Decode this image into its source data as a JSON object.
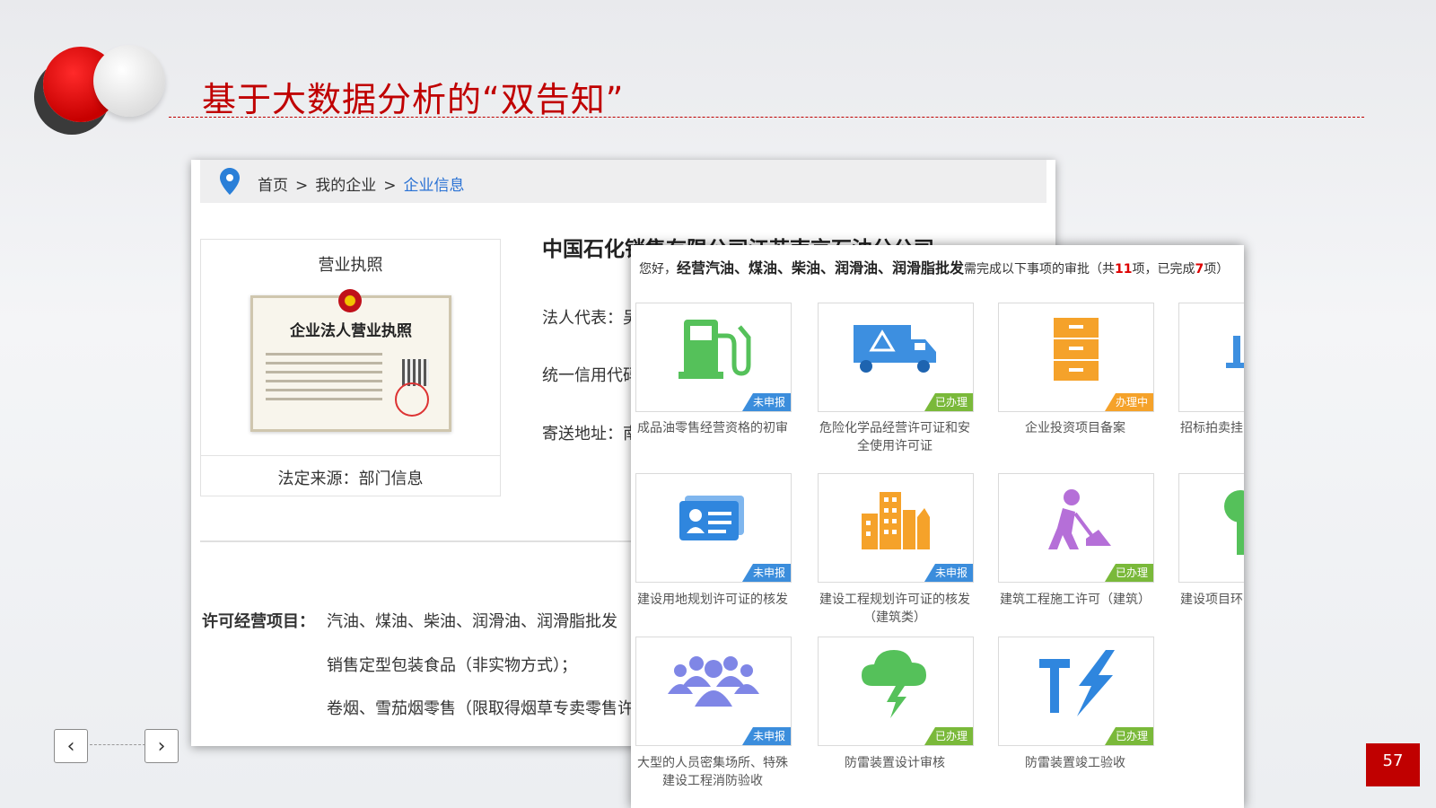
{
  "slide": {
    "title": "基于大数据分析的“双告知”",
    "page_number": "57",
    "prev_label": "‹",
    "next_label": "›"
  },
  "browser": {
    "breadcrumb": {
      "home": "首页",
      "sep": ">",
      "mid": "我的企业",
      "current": "企业信息"
    },
    "license": {
      "title": "营业执照",
      "cert_heading": "企业法人营业执照",
      "source": "法定来源：部门信息"
    },
    "company_name": "中国石化销售有限公司江苏南京石油分公司",
    "fields": {
      "legal_rep": "法人代表：吴",
      "credit_code": "统一信用代码",
      "address": "寄送地址：南"
    },
    "permit": {
      "label": "许可经营项目：",
      "items": [
        "汽油、煤油、柴油、润滑油、润滑脂批发",
        "销售定型包装食品（非实物方式）；",
        "卷烟、雪茄烟零售（限取得烟草专卖零售许"
      ]
    }
  },
  "approvals": {
    "header": {
      "greeting": "您好，",
      "scope": "经营汽油、煤油、柴油、润滑油、润滑脂批发",
      "need": "需完成以下事项的审批（共",
      "total": "11",
      "mid": "项，已完成",
      "done": "7",
      "end": "项）"
    },
    "tiles": [
      {
        "caption": "成品油零售经营资格的初审",
        "status": "未申报",
        "status_color": "#3b8ddc",
        "icon": "gas-pump-icon"
      },
      {
        "caption": "危险化学品经营许可证和安全使用许可证",
        "status": "已办理",
        "status_color": "#7ab93a",
        "icon": "hazmat-truck-icon"
      },
      {
        "caption": "企业投资项目备案",
        "status": "办理中",
        "status_color": "#f5a22a",
        "icon": "file-cabinet-icon"
      },
      {
        "caption": "招标拍卖挂",
        "status": "",
        "status_color": "",
        "icon": "gavel-icon"
      },
      {
        "caption": "建设用地规划许可证的核发",
        "status": "未申报",
        "status_color": "#3b8ddc",
        "icon": "id-card-icon"
      },
      {
        "caption": "建设工程规划许可证的核发（建筑类）",
        "status": "未申报",
        "status_color": "#3b8ddc",
        "icon": "buildings-icon"
      },
      {
        "caption": "建筑工程施工许可（建筑）",
        "status": "已办理",
        "status_color": "#7ab93a",
        "icon": "construction-worker-icon"
      },
      {
        "caption": "建设项目环",
        "status": "",
        "status_color": "",
        "icon": "tree-icon"
      },
      {
        "caption": "大型的人员密集场所、特殊建设工程消防验收",
        "status": "未申报",
        "status_color": "#3b8ddc",
        "icon": "crowd-icon"
      },
      {
        "caption": "防雷装置设计审核",
        "status": "已办理",
        "status_color": "#7ab93a",
        "icon": "lightning-cloud-icon"
      },
      {
        "caption": "防雷装置竣工验收",
        "status": "已办理",
        "status_color": "#7ab93a",
        "icon": "lightning-tool-icon"
      }
    ]
  }
}
